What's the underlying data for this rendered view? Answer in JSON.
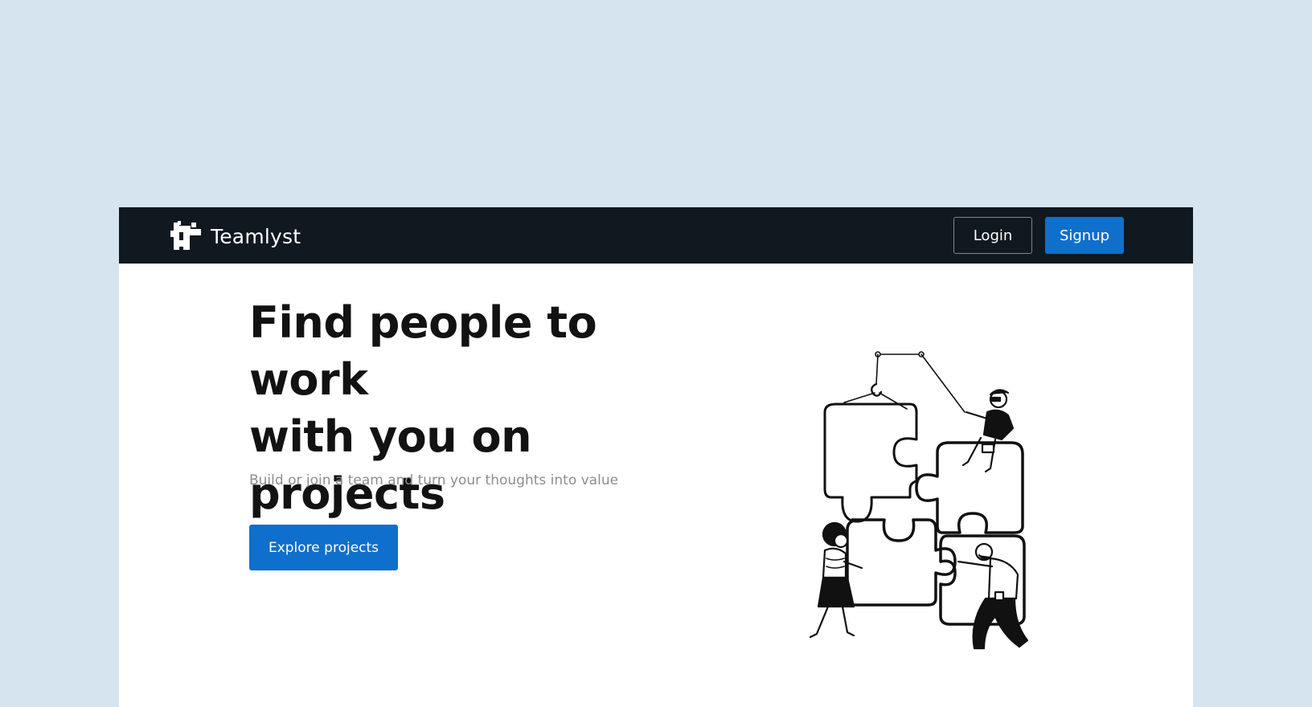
{
  "navbar": {
    "brand_name": "Teamlyst",
    "login_label": "Login",
    "signup_label": "Signup"
  },
  "hero": {
    "title_line1": "Find people to work",
    "title_line2": "with you on projects",
    "subtitle": "Build or join a team and turn your thoughts into value",
    "cta_label": "Explore projects"
  },
  "colors": {
    "page_background": "#d6e4ef",
    "navbar_background": "#101820",
    "primary_button": "#0f6fcc",
    "heading_text": "#121212",
    "subtitle_text": "#8a8e93"
  },
  "icons": {
    "logo": "teamlyst-logo-icon",
    "illustration": "puzzle-teamwork-illustration"
  }
}
